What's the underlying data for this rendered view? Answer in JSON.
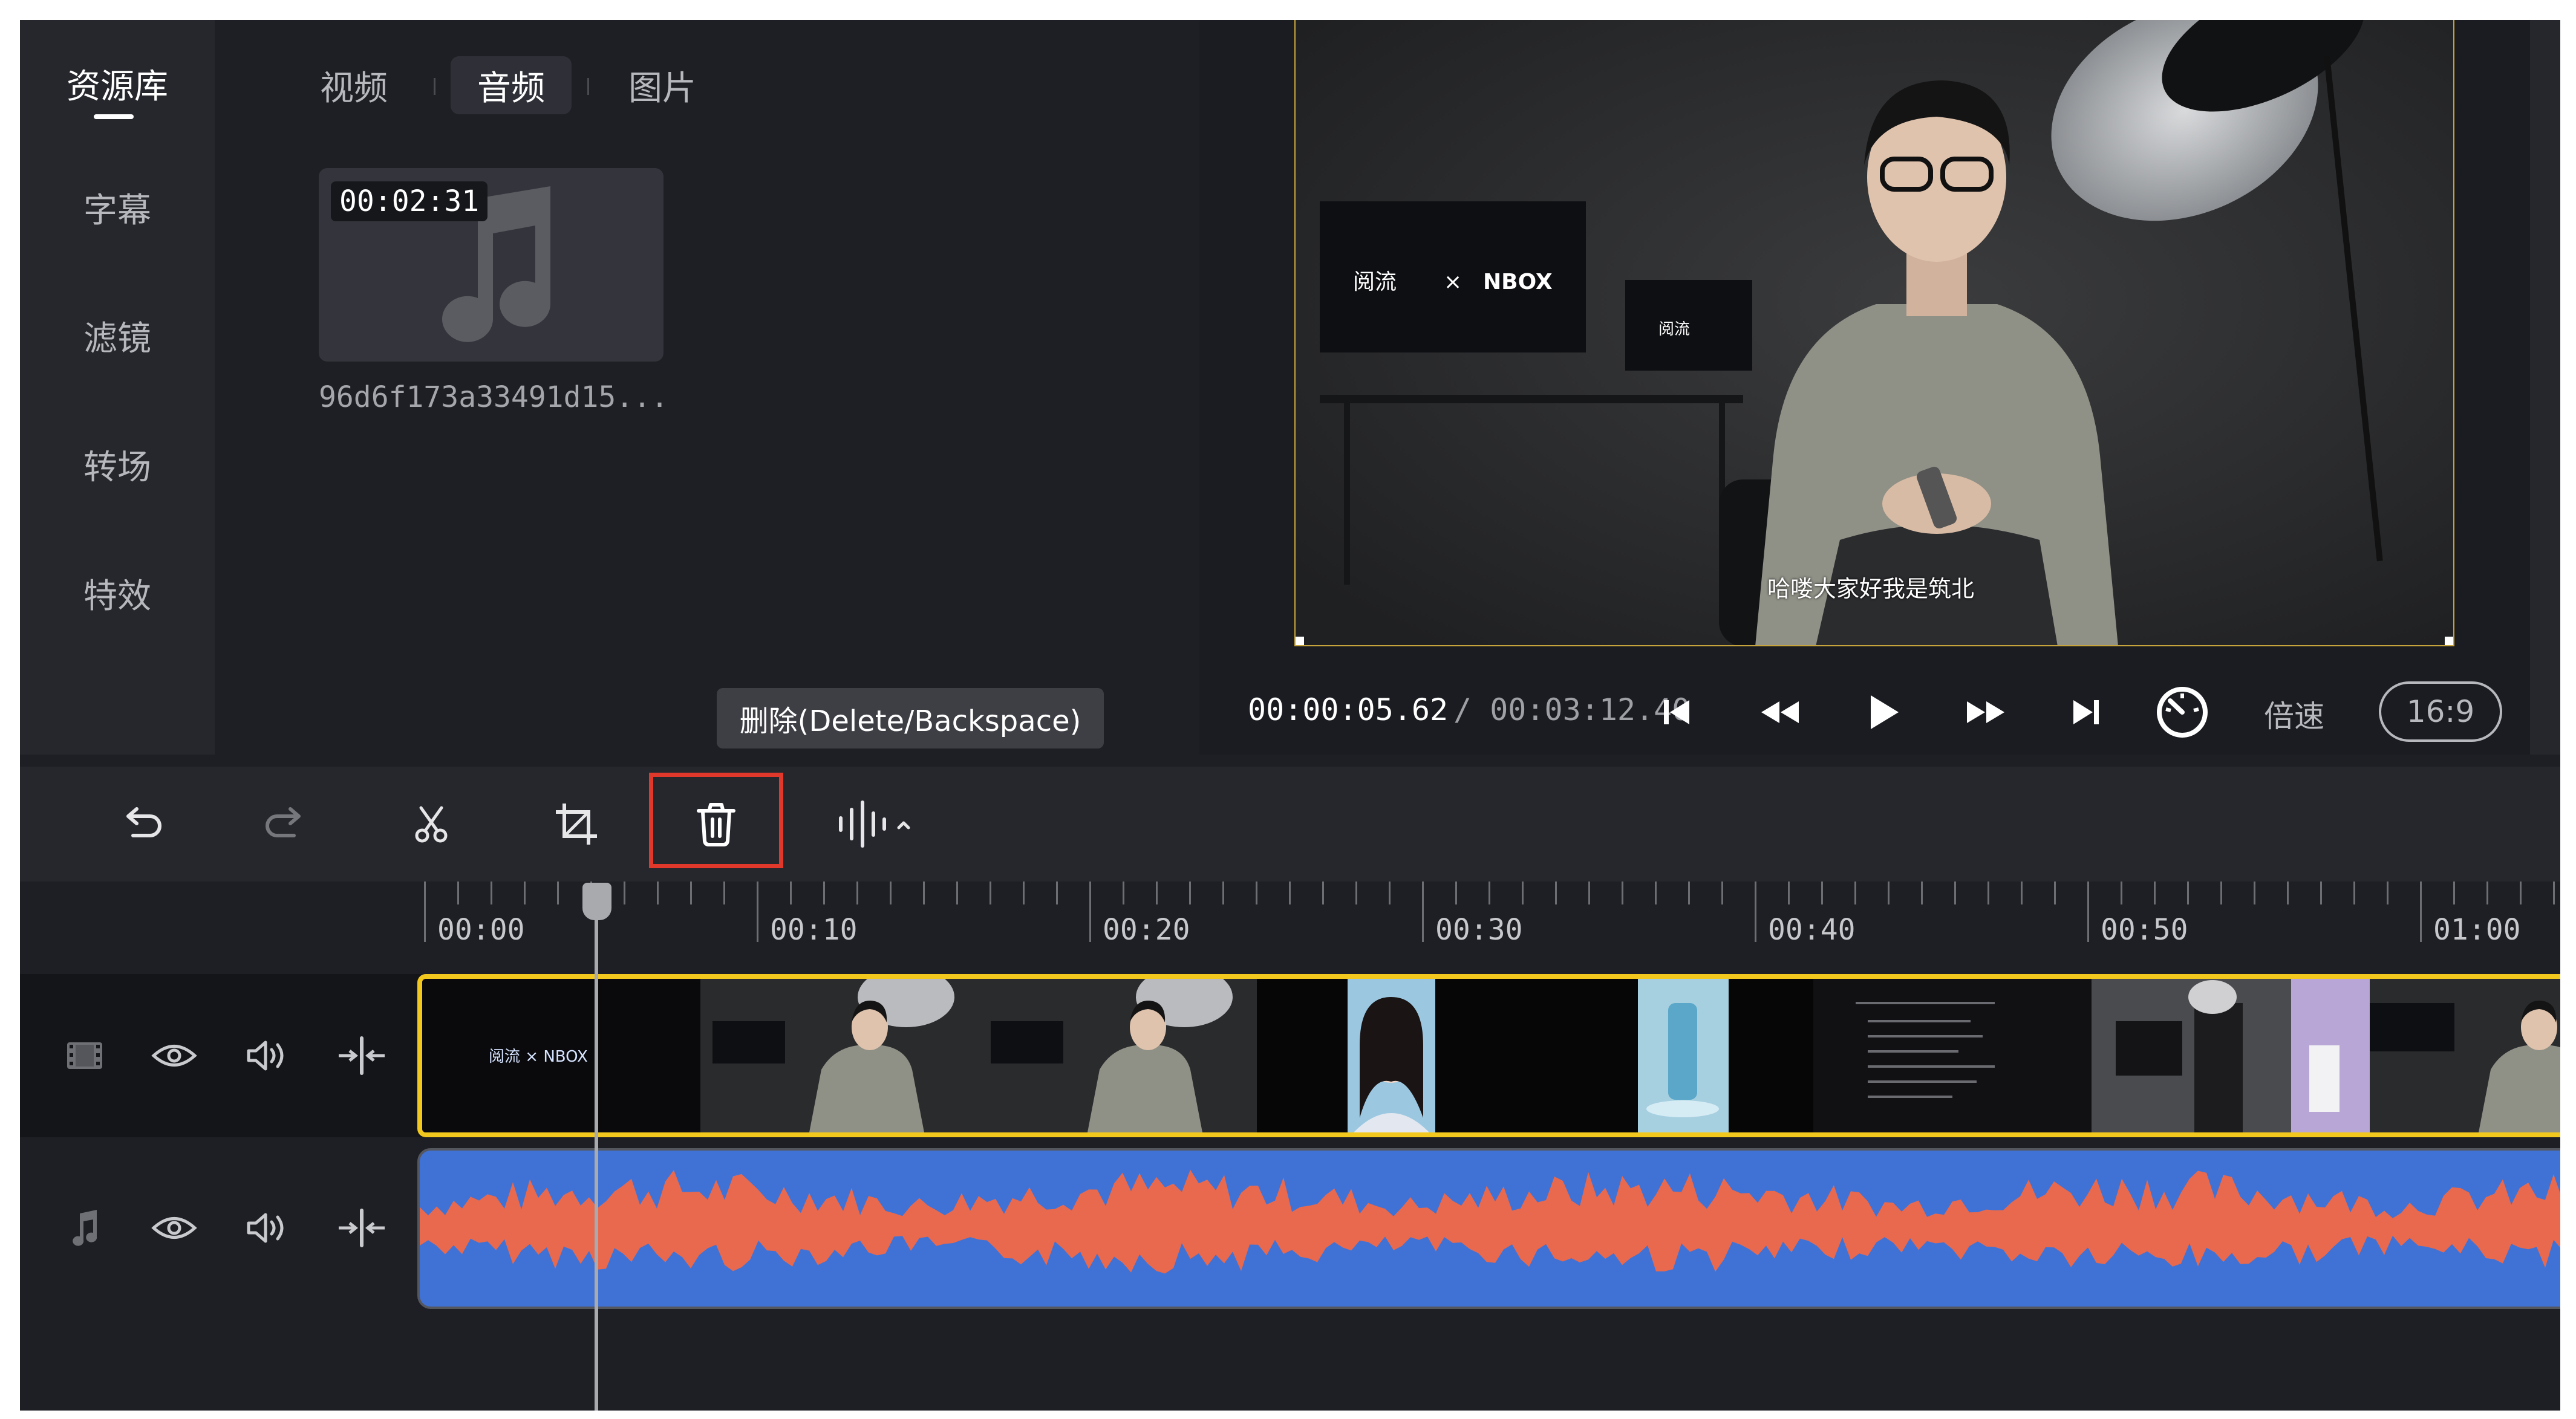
{
  "left_nav": {
    "items": [
      {
        "label": "资源库",
        "active": true
      },
      {
        "label": "字幕",
        "active": false
      },
      {
        "label": "滤镜",
        "active": false
      },
      {
        "label": "转场",
        "active": false
      },
      {
        "label": "特效",
        "active": false
      }
    ]
  },
  "asset_panel": {
    "tabs": [
      {
        "label": "视频",
        "active": false
      },
      {
        "label": "音频",
        "active": true
      },
      {
        "label": "图片",
        "active": false
      }
    ],
    "card": {
      "duration": "00:02:31",
      "name": "96d6f173a33491d15...",
      "icon": "music-note-icon"
    },
    "tooltip": "删除(Delete/Backspace)"
  },
  "preview": {
    "subtitle": "哈喽大家好我是筑北",
    "screen_brand_1": "阅流",
    "screen_brand_x": "×",
    "screen_brand_2": "NBOX",
    "screen_brand_small": "阅流",
    "time_current": "00:00:05.62",
    "time_total": "/ 00:03:12.40",
    "speed_label": "倍速",
    "ratio": "16:9",
    "icons": [
      "skip-start-icon",
      "rewind-icon",
      "play-icon",
      "fast-forward-icon",
      "skip-end-icon",
      "speedometer-icon"
    ]
  },
  "toolbar": {
    "tools": [
      "undo-icon",
      "redo-icon",
      "scissors-icon",
      "crop-icon",
      "trash-icon",
      "audio-waveform-icon"
    ],
    "highlight_color": "#e0392b"
  },
  "ruler": {
    "labels": [
      "00:00",
      "00:10",
      "00:20",
      "00:30",
      "00:40",
      "00:50",
      "01:00"
    ]
  },
  "tracks": {
    "video_icons": [
      "film-icon",
      "eye-icon",
      "volume-icon",
      "split-icon"
    ],
    "audio_icons": [
      "music-note-icon",
      "eye-icon",
      "volume-icon",
      "split-icon"
    ],
    "clip_border_color": "#f2c81e",
    "waveform_color": "#e8694d",
    "audio_bg_color": "#4072d6",
    "frame_brand": "阅流 × NBOX"
  }
}
